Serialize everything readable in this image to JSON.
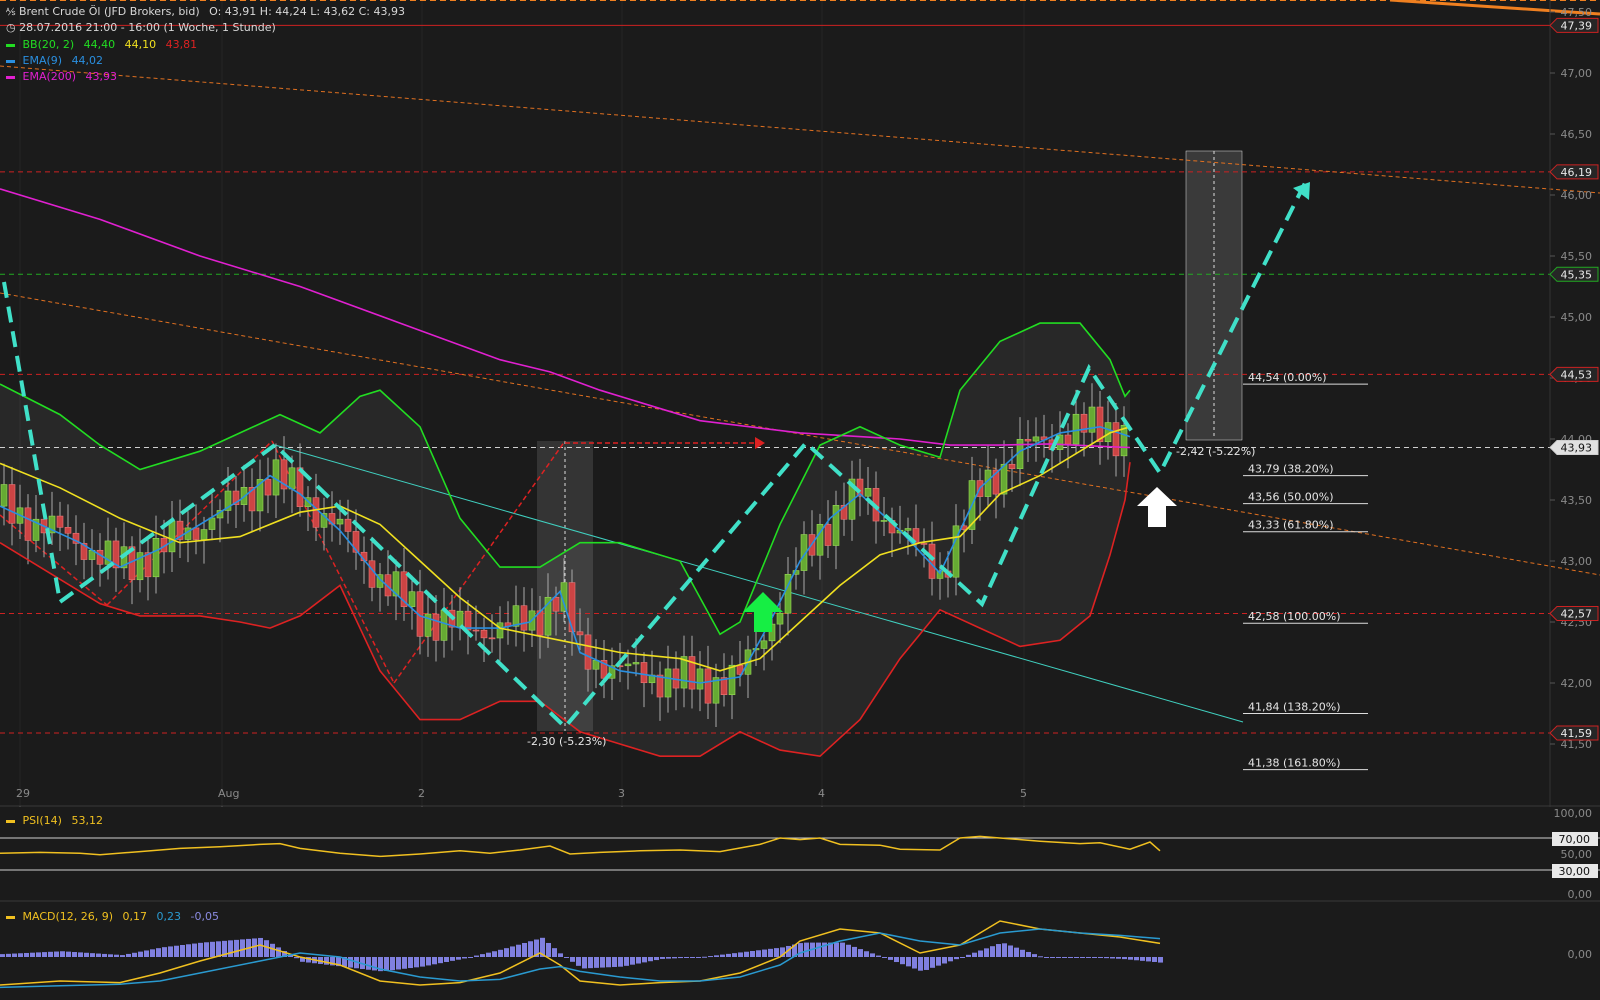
{
  "header": {
    "instrument": "Brent Crude Öl (JFD Brokers, bid)",
    "ohlc": "O: 43,91   H: 44,24   L: 43,62   C: 43,93",
    "period": "28.07.2016 21:00 - 16:00 (1 Woche, 1 Stunde)"
  },
  "indicators": {
    "bb": {
      "label": "BB(20, 2)",
      "v1": "44,40",
      "v2": "44,10",
      "v3": "43,81",
      "color": "#22dd22"
    },
    "ema9": {
      "label": "EMA(9)",
      "v1": "44,02",
      "color": "#2a8fe0"
    },
    "ema200": {
      "label": "EMA(200)",
      "v1": "43,93",
      "color": "#e020d0"
    }
  },
  "chart_data": {
    "type": "line",
    "title": "Brent Crude Öl (JFD Brokers, bid)",
    "x_ticks": [
      "29",
      "Aug",
      "2",
      "3",
      "4",
      "5"
    ],
    "y_ticks": [
      "47,50",
      "47,00",
      "46,50",
      "46,00",
      "45,50",
      "45,00",
      "44,50",
      "44,00",
      "43,50",
      "43,00",
      "42,50",
      "42,00",
      "41,50"
    ],
    "ylim": [
      41.3,
      47.6
    ],
    "price_tags": [
      {
        "value": 47.39,
        "label": "47,39",
        "color": "#cc2222"
      },
      {
        "value": 46.19,
        "label": "46,19",
        "color": "#cc2222"
      },
      {
        "value": 45.35,
        "label": "45,35",
        "color": "#22aa22"
      },
      {
        "value": 44.53,
        "label": "44,53",
        "color": "#cc2222"
      },
      {
        "value": 43.93,
        "label": "43,93",
        "color": "#cfcfcf"
      },
      {
        "value": 42.57,
        "label": "42,57",
        "color": "#cc2222"
      },
      {
        "value": 41.59,
        "label": "41,59",
        "color": "#cc2222"
      }
    ],
    "fibonacci": [
      {
        "label": "44,54 (0.00%)",
        "value": 44.54
      },
      {
        "label": "43,79 (38.20%)",
        "value": 43.79
      },
      {
        "label": "43,56 (50.00%)",
        "value": 43.56
      },
      {
        "label": "43,33 (61.80%)",
        "value": 43.33
      },
      {
        "label": "42,58 (100.00%)",
        "value": 42.58
      },
      {
        "label": "41,84 (138.20%)",
        "value": 41.84
      },
      {
        "label": "41,38 (161.80%)",
        "value": 41.38
      }
    ],
    "measurements": [
      "-2,30 (-5.23%)",
      "-2,42 (-5.22%)"
    ],
    "series": [
      {
        "name": "EMA(200)",
        "color": "#e020d0",
        "x": [
          0,
          100,
          200,
          300,
          400,
          500,
          550,
          600,
          700,
          800,
          900,
          950,
          1000,
          1050,
          1100,
          1130
        ],
        "y": [
          46.05,
          45.8,
          45.5,
          45.25,
          44.95,
          44.65,
          44.55,
          44.4,
          44.15,
          44.05,
          44.0,
          43.95,
          43.95,
          43.96,
          43.94,
          43.93
        ]
      },
      {
        "name": "EMA(9)",
        "color": "#2a8fe0",
        "x": [
          0,
          40,
          80,
          120,
          160,
          200,
          240,
          270,
          300,
          340,
          380,
          420,
          460,
          500,
          530,
          560,
          580,
          620,
          660,
          700,
          740,
          770,
          800,
          830,
          860,
          900,
          940,
          980,
          1020,
          1060,
          1100,
          1130
        ],
        "y": [
          43.45,
          43.3,
          43.15,
          42.95,
          43.1,
          43.3,
          43.5,
          43.7,
          43.55,
          43.25,
          42.85,
          42.55,
          42.45,
          42.45,
          42.5,
          42.75,
          42.25,
          42.1,
          42.05,
          42.0,
          42.05,
          42.5,
          43.0,
          43.35,
          43.55,
          43.25,
          42.9,
          43.6,
          43.9,
          44.05,
          44.1,
          44.02
        ]
      },
      {
        "name": "BB(20, 2) mid",
        "color": "#f0e020",
        "x": [
          0,
          60,
          120,
          180,
          240,
          300,
          340,
          380,
          420,
          460,
          500,
          560,
          620,
          680,
          720,
          760,
          800,
          840,
          880,
          920,
          960,
          1000,
          1040,
          1080,
          1110,
          1130
        ],
        "y": [
          43.8,
          43.6,
          43.35,
          43.15,
          43.2,
          43.4,
          43.45,
          43.3,
          43.0,
          42.7,
          42.45,
          42.35,
          42.25,
          42.2,
          42.1,
          42.2,
          42.5,
          42.8,
          43.05,
          43.15,
          43.2,
          43.55,
          43.7,
          43.9,
          44.05,
          44.1
        ]
      },
      {
        "name": "BB(20, 2) upper",
        "color": "#22dd22",
        "x": [
          0,
          60,
          100,
          140,
          200,
          240,
          280,
          320,
          360,
          380,
          420,
          460,
          500,
          540,
          580,
          620,
          680,
          720,
          740,
          780,
          820,
          860,
          900,
          940,
          960,
          1000,
          1040,
          1080,
          1110,
          1125,
          1130
        ],
        "y": [
          44.45,
          44.2,
          43.95,
          43.75,
          43.9,
          44.05,
          44.2,
          44.05,
          44.35,
          44.4,
          44.1,
          43.35,
          42.95,
          42.95,
          43.15,
          43.15,
          43.0,
          42.4,
          42.5,
          43.3,
          43.95,
          44.1,
          43.95,
          43.85,
          44.4,
          44.8,
          44.95,
          44.95,
          44.65,
          44.35,
          44.4
        ]
      },
      {
        "name": "BB(20, 2) lower",
        "color": "#dd2222",
        "x": [
          0,
          60,
          100,
          140,
          200,
          240,
          270,
          300,
          340,
          380,
          420,
          460,
          500,
          540,
          580,
          620,
          660,
          700,
          740,
          780,
          820,
          860,
          900,
          940,
          980,
          1020,
          1060,
          1090,
          1110,
          1125,
          1130
        ],
        "y": [
          43.15,
          42.85,
          42.65,
          42.55,
          42.55,
          42.5,
          42.45,
          42.55,
          42.8,
          42.1,
          41.7,
          41.7,
          41.85,
          41.85,
          41.6,
          41.5,
          41.4,
          41.4,
          41.6,
          41.45,
          41.4,
          41.7,
          42.2,
          42.6,
          42.45,
          42.3,
          42.35,
          42.55,
          43.05,
          43.5,
          43.81
        ]
      }
    ],
    "rsi": {
      "label": "PSI(14)",
      "value": "53,12",
      "levels": [
        "100,00",
        "70,00",
        "50,00",
        "30,00",
        "0,00"
      ]
    },
    "macd": {
      "label": "MACD(12, 26, 9)",
      "v1": "0,17",
      "v2": "0,23",
      "v3": "-0,05",
      "zero": "0,00"
    }
  }
}
